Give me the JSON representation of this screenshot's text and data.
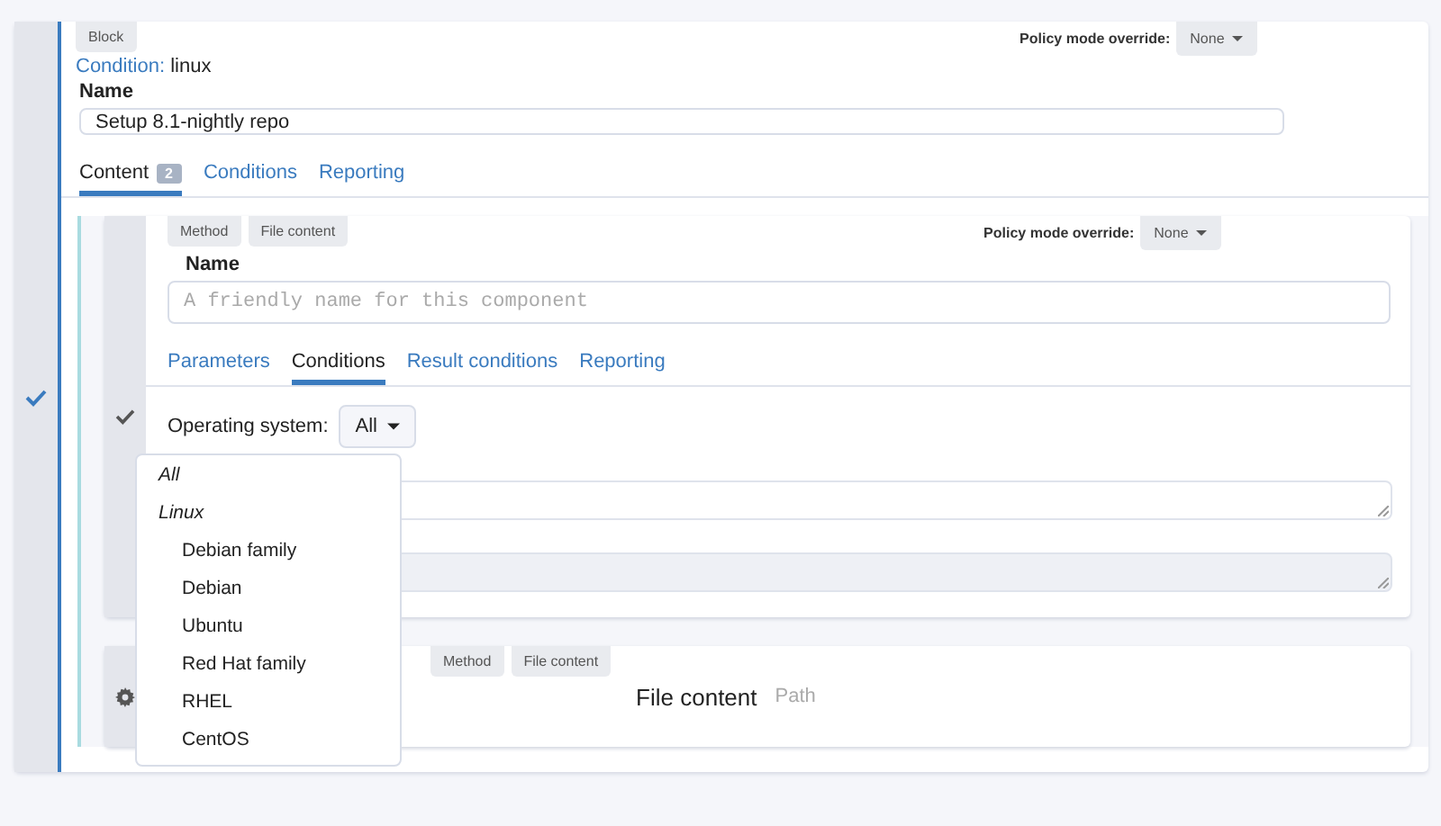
{
  "block": {
    "badge": "Block",
    "condition_label": "Condition:",
    "condition_value": "linux",
    "policy_label": "Policy mode override:",
    "policy_value": "None",
    "name_label": "Name",
    "name_value": "Setup 8.1-nightly repo",
    "tabs": [
      {
        "label": "Content",
        "count": "2",
        "selected": true
      },
      {
        "label": "Conditions",
        "selected": false
      },
      {
        "label": "Reporting",
        "selected": false
      }
    ]
  },
  "components": [
    {
      "kind": "expanded",
      "badges": [
        "Method",
        "File content"
      ],
      "policy_label": "Policy mode override:",
      "policy_value": "None",
      "name_label": "Name",
      "name_placeholder": "A friendly name for this component",
      "tabs": [
        {
          "label": "Parameters",
          "selected": false
        },
        {
          "label": "Conditions",
          "selected": true
        },
        {
          "label": "Result conditions",
          "selected": false
        },
        {
          "label": "Reporting",
          "selected": false
        }
      ],
      "os_label": "Operating system:",
      "os_value": "All",
      "textareas": [
        {
          "disabled": false
        },
        {
          "disabled": true
        }
      ]
    },
    {
      "kind": "collapsed",
      "badges": [
        "Method",
        "File content"
      ],
      "title": "File content",
      "field_label": "Path"
    }
  ],
  "os_menu": {
    "items": [
      {
        "label": "All"
      },
      {
        "label": "Linux",
        "children": [
          {
            "label": "Debian family"
          },
          {
            "label": "Debian"
          },
          {
            "label": "Ubuntu"
          },
          {
            "label": "Red Hat family"
          },
          {
            "label": "RHEL"
          },
          {
            "label": "CentOS"
          }
        ]
      }
    ]
  }
}
